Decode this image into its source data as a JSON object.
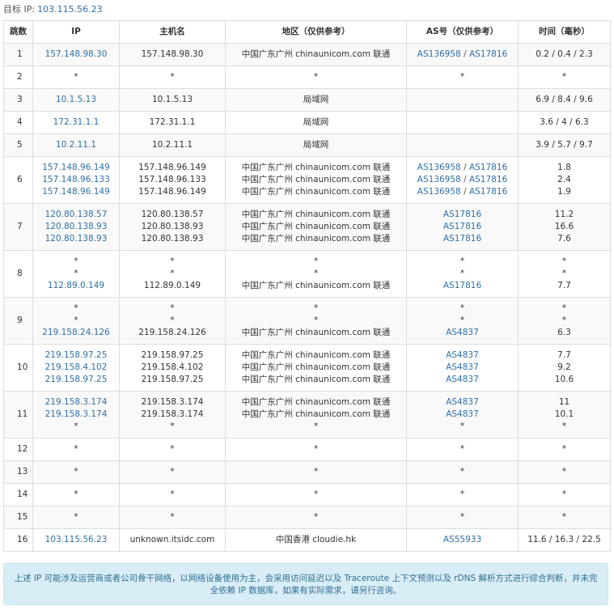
{
  "target": {
    "label": "目标 IP:",
    "ip": "103.115.56.23"
  },
  "headers": [
    "跳数",
    "IP",
    "主机名",
    "地区（仅供参考）",
    "AS号（仅供参考）",
    "时间（毫秒）"
  ],
  "rows": [
    {
      "hop": "1",
      "entries": [
        {
          "ip": "157.148.98.30",
          "host": "157.148.98.30",
          "region": "中国广东广州 chinaunicom.com 联通",
          "as": [
            "AS136958",
            "AS17816"
          ],
          "time": "0.2 / 0.4 / 2.3"
        }
      ]
    },
    {
      "hop": "2",
      "entries": [
        {
          "ip": "*",
          "host": "*",
          "region": "*",
          "as": [
            "*"
          ],
          "time": "*"
        }
      ]
    },
    {
      "hop": "3",
      "entries": [
        {
          "ip": "10.1.5.13",
          "host": "10.1.5.13",
          "region": "局域网",
          "as": [],
          "time": "6.9 / 8.4 / 9.6"
        }
      ]
    },
    {
      "hop": "4",
      "entries": [
        {
          "ip": "172.31.1.1",
          "host": "172.31.1.1",
          "region": "局域网",
          "as": [],
          "time": "3.6 / 4 / 6.3"
        }
      ]
    },
    {
      "hop": "5",
      "entries": [
        {
          "ip": "10.2.11.1",
          "host": "10.2.11.1",
          "region": "局域网",
          "as": [],
          "time": "3.9 / 5.7 / 9.7"
        }
      ]
    },
    {
      "hop": "6",
      "entries": [
        {
          "ip": "157.148.96.149",
          "host": "157.148.96.149",
          "region": "中国广东广州 chinaunicom.com 联通",
          "as": [
            "AS136958",
            "AS17816"
          ],
          "time": "1.8"
        },
        {
          "ip": "157.148.96.133",
          "host": "157.148.96.133",
          "region": "中国广东广州 chinaunicom.com 联通",
          "as": [
            "AS136958",
            "AS17816"
          ],
          "time": "2.4"
        },
        {
          "ip": "157.148.96.149",
          "host": "157.148.96.149",
          "region": "中国广东广州 chinaunicom.com 联通",
          "as": [
            "AS136958",
            "AS17816"
          ],
          "time": "1.9"
        }
      ]
    },
    {
      "hop": "7",
      "entries": [
        {
          "ip": "120.80.138.57",
          "host": "120.80.138.57",
          "region": "中国广东广州 chinaunicom.com 联通",
          "as": [
            "AS17816"
          ],
          "time": "11.2"
        },
        {
          "ip": "120.80.138.93",
          "host": "120.80.138.93",
          "region": "中国广东广州 chinaunicom.com 联通",
          "as": [
            "AS17816"
          ],
          "time": "16.6"
        },
        {
          "ip": "120.80.138.93",
          "host": "120.80.138.93",
          "region": "中国广东广州 chinaunicom.com 联通",
          "as": [
            "AS17816"
          ],
          "time": "7.6"
        }
      ]
    },
    {
      "hop": "8",
      "entries": [
        {
          "ip": "*",
          "host": "*",
          "region": "*",
          "as": [
            "*"
          ],
          "time": "*"
        },
        {
          "ip": "*",
          "host": "*",
          "region": "*",
          "as": [
            "*"
          ],
          "time": "*"
        },
        {
          "ip": "112.89.0.149",
          "host": "112.89.0.149",
          "region": "中国广东广州 chinaunicom.com 联通",
          "as": [
            "AS17816"
          ],
          "time": "7.7"
        }
      ]
    },
    {
      "hop": "9",
      "entries": [
        {
          "ip": "*",
          "host": "*",
          "region": "*",
          "as": [
            "*"
          ],
          "time": "*"
        },
        {
          "ip": "*",
          "host": "*",
          "region": "*",
          "as": [
            "*"
          ],
          "time": "*"
        },
        {
          "ip": "219.158.24.126",
          "host": "219.158.24.126",
          "region": "中国广东广州 chinaunicom.com 联通",
          "as": [
            "AS4837"
          ],
          "time": "6.3"
        }
      ]
    },
    {
      "hop": "10",
      "entries": [
        {
          "ip": "219.158.97.25",
          "host": "219.158.97.25",
          "region": "中国广东广州 chinaunicom.com 联通",
          "as": [
            "AS4837"
          ],
          "time": "7.7"
        },
        {
          "ip": "219.158.4.102",
          "host": "219.158.4.102",
          "region": "中国广东广州 chinaunicom.com 联通",
          "as": [
            "AS4837"
          ],
          "time": "9.2"
        },
        {
          "ip": "219.158.97.25",
          "host": "219.158.97.25",
          "region": "中国广东广州 chinaunicom.com 联通",
          "as": [
            "AS4837"
          ],
          "time": "10.6"
        }
      ]
    },
    {
      "hop": "11",
      "entries": [
        {
          "ip": "219.158.3.174",
          "host": "219.158.3.174",
          "region": "中国广东广州 chinaunicom.com 联通",
          "as": [
            "AS4837"
          ],
          "time": "11"
        },
        {
          "ip": "219.158.3.174",
          "host": "219.158.3.174",
          "region": "中国广东广州 chinaunicom.com 联通",
          "as": [
            "AS4837"
          ],
          "time": "10.1"
        },
        {
          "ip": "*",
          "host": "*",
          "region": "*",
          "as": [
            "*"
          ],
          "time": "*"
        }
      ]
    },
    {
      "hop": "12",
      "entries": [
        {
          "ip": "*",
          "host": "*",
          "region": "*",
          "as": [
            "*"
          ],
          "time": "*"
        }
      ]
    },
    {
      "hop": "13",
      "entries": [
        {
          "ip": "*",
          "host": "*",
          "region": "*",
          "as": [
            "*"
          ],
          "time": "*"
        }
      ]
    },
    {
      "hop": "14",
      "entries": [
        {
          "ip": "*",
          "host": "*",
          "region": "*",
          "as": [
            "*"
          ],
          "time": "*"
        }
      ]
    },
    {
      "hop": "15",
      "entries": [
        {
          "ip": "*",
          "host": "*",
          "region": "*",
          "as": [
            "*"
          ],
          "time": "*"
        }
      ]
    },
    {
      "hop": "16",
      "entries": [
        {
          "ip": "103.115.56.23",
          "host": "unknown.itsidc.com",
          "region": "中国香港 cloudie.hk",
          "as": [
            "AS55933"
          ],
          "time": "11.6 / 16.3 / 22.5"
        }
      ]
    }
  ],
  "notice": {
    "line1": "上述 IP 可能涉及运营商或者公司骨干网络，以网络设备使用为主，会采用访问延迟以及 Traceroute 上下文预测以及 rDNS 解析方式进行综合判断，并未完",
    "line2": "全依赖 IP 数据库，如果有实际需求，请另行咨询。"
  },
  "colors": {
    "link": "#2f6fa7",
    "notice_bg": "#d9edf7",
    "notice_text": "#31708f",
    "border": "#dddddd"
  }
}
